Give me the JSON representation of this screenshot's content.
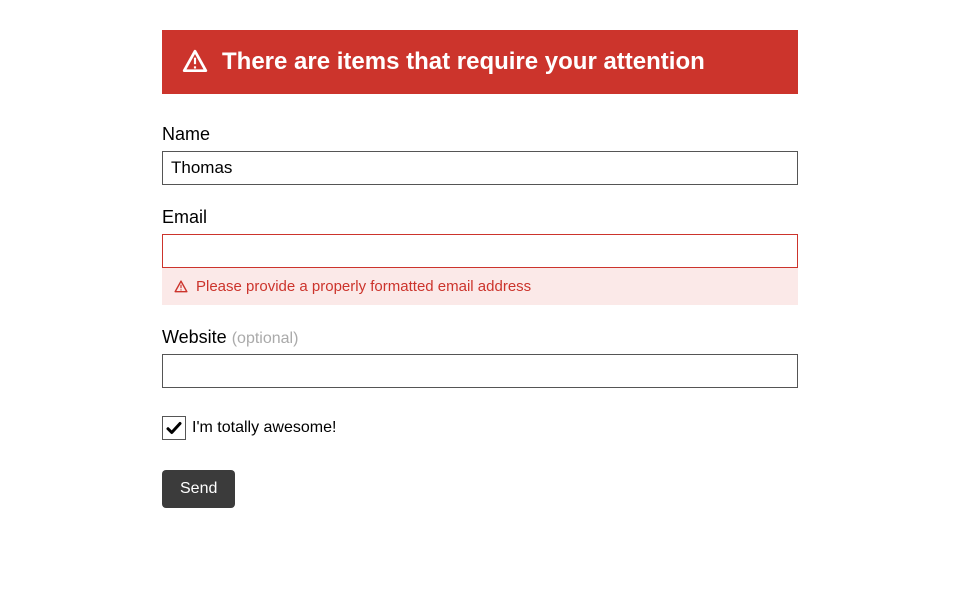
{
  "alert": {
    "message": "There are items that require your attention"
  },
  "form": {
    "name": {
      "label": "Name",
      "value": "Thomas"
    },
    "email": {
      "label": "Email",
      "value": "",
      "error": "Please provide a properly formatted email address"
    },
    "website": {
      "label": "Website",
      "optional_text": "(optional)",
      "value": ""
    },
    "awesome": {
      "label": "I'm totally awesome!",
      "checked": true
    },
    "submit_label": "Send"
  },
  "colors": {
    "error": "#cc342c",
    "error_bg": "#fbe9e8",
    "button_bg": "#3b3b3b"
  }
}
